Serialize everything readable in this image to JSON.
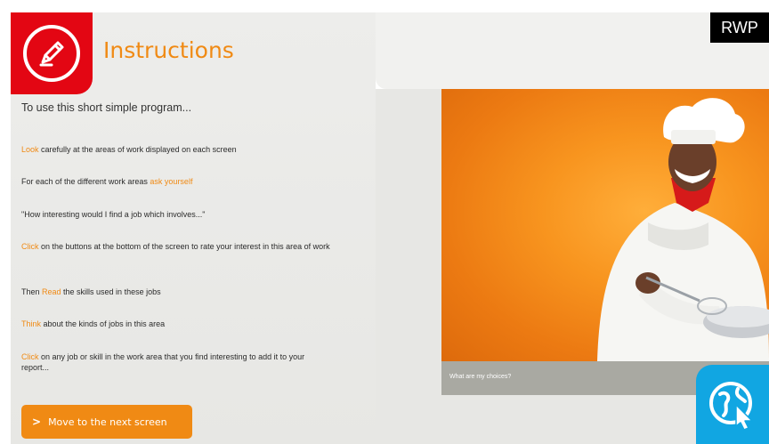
{
  "header": {
    "title": "Instructions",
    "logo_icon": "pencil-icon"
  },
  "intro": "To use this short simple program...",
  "steps": [
    {
      "highlight": "Look",
      "text": " carefully at the areas of work displayed on each screen"
    },
    {
      "prefix": "For each of the different work areas ",
      "highlight": "ask yourself"
    },
    {
      "text": "\"How interesting would I find a job which involves...\""
    },
    {
      "highlight": "Click",
      "text": " on the buttons at the bottom of the screen to rate your interest in this area of work"
    },
    {
      "prefix": "Then ",
      "highlight": "Read",
      "text": " the skills used in these jobs"
    },
    {
      "highlight": "Think",
      "text": " about the kinds of jobs in this area"
    },
    {
      "highlight": "Click",
      "text": " on any job or skill in the work area that you find interesting to add it to your report..."
    }
  ],
  "next_button": {
    "label": "Move to the next screen",
    "icon": "chevron-right-icon"
  },
  "photo": {
    "caption": "What are my choices?"
  },
  "badge": "RWP",
  "corner_icon": "globe-cursor-icon",
  "colors": {
    "accent": "#f08a14",
    "logo_red": "#e30613",
    "globe_blue": "#11a6e2",
    "panel_grey": "#e7e7e4",
    "caption_grey": "#a9a9a2"
  }
}
